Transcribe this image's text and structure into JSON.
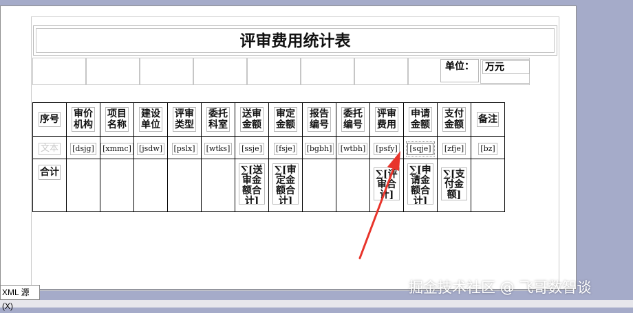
{
  "report": {
    "title": "评审费用统计表",
    "unit_label": "单位：",
    "unit_value": "万元"
  },
  "columns": [
    {
      "header": "序号",
      "field": "文本",
      "total": "合计"
    },
    {
      "header": "审价机构",
      "field": "[dsjg]",
      "total": ""
    },
    {
      "header": "项目名称",
      "field": "[xmmc]",
      "total": ""
    },
    {
      "header": "建设单位",
      "field": "[jsdw]",
      "total": ""
    },
    {
      "header": "评审类型",
      "field": "[pslx]",
      "total": ""
    },
    {
      "header": "委托科室",
      "field": "[wtks]",
      "total": ""
    },
    {
      "header": "送审金额",
      "field": "[ssje]",
      "total": "∑[送审金额合计]"
    },
    {
      "header": "审定金额",
      "field": "[fsje]",
      "total": "∑[审定金额合计]"
    },
    {
      "header": "报告编号",
      "field": "[bgbh]",
      "total": ""
    },
    {
      "header": "委托编号",
      "field": "[wtbh]",
      "total": ""
    },
    {
      "header": "评审费用",
      "field": "[psfy]",
      "total": "∑[评审合计]"
    },
    {
      "header": "申请金额",
      "field": "[sqje]",
      "total": "∑[申请金额合计]"
    },
    {
      "header": "支付金额",
      "field": "[zfje]",
      "total": "∑[支付金额]"
    },
    {
      "header": "备注",
      "field": "[bz]",
      "total": ""
    }
  ],
  "bottom_tab": "XML 源(X)",
  "watermark": "掘金技术社区 @ 飞哥数智谈",
  "colors": {
    "background": "#a5abc9",
    "arrow": "#e8342b"
  }
}
